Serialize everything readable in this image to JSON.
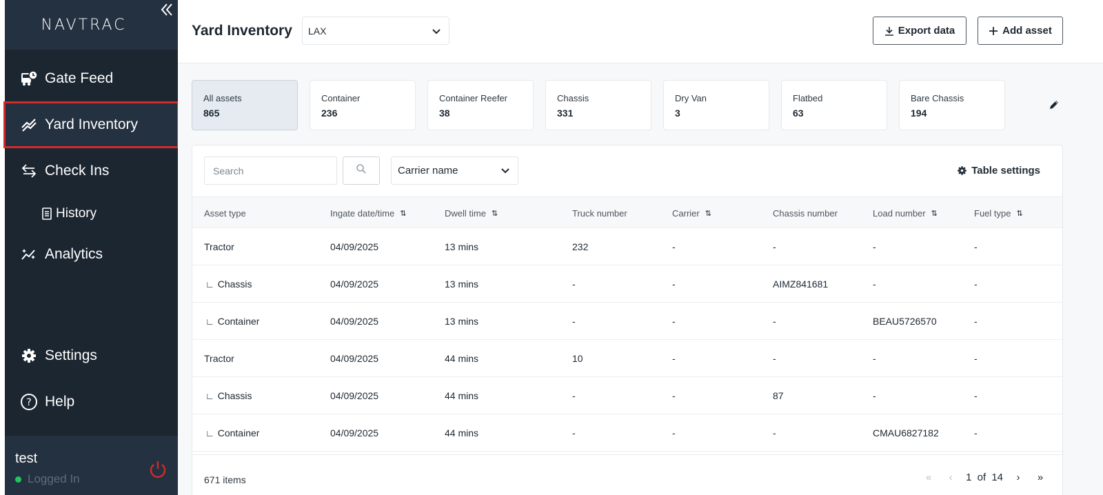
{
  "sidebar": {
    "logo": "NAVTRAC",
    "items": [
      {
        "label": "Gate Feed"
      },
      {
        "label": "Yard Inventory"
      },
      {
        "label": "Check Ins"
      },
      {
        "label": "History"
      },
      {
        "label": "Analytics"
      }
    ],
    "bottom": [
      {
        "label": "Settings"
      },
      {
        "label": "Help"
      }
    ],
    "user": {
      "name": "test",
      "status": "Logged In"
    }
  },
  "header": {
    "title": "Yard Inventory",
    "location": "LAX",
    "export_label": "Export data",
    "add_label": "Add asset"
  },
  "cards": [
    {
      "label": "All assets",
      "value": "865"
    },
    {
      "label": "Container",
      "value": "236"
    },
    {
      "label": "Container Reefer",
      "value": "38"
    },
    {
      "label": "Chassis",
      "value": "331"
    },
    {
      "label": "Dry Van",
      "value": "3"
    },
    {
      "label": "Flatbed",
      "value": "63"
    },
    {
      "label": "Bare Chassis",
      "value": "194"
    }
  ],
  "toolbar": {
    "search_placeholder": "Search",
    "carrier_label": "Carrier name",
    "table_settings": "Table settings"
  },
  "table": {
    "columns": [
      "Asset type",
      "Ingate date/time",
      "Dwell time",
      "Truck number",
      "Carrier",
      "Chassis number",
      "Load number",
      "Fuel type"
    ],
    "rows": [
      {
        "asset": "Tractor",
        "child": false,
        "ingate": "04/09/2025",
        "dwell": "13 mins",
        "truck": "232",
        "carrier": "-",
        "chassis": "-",
        "load": "-",
        "fuel": "-"
      },
      {
        "asset": "Chassis",
        "child": true,
        "ingate": "04/09/2025",
        "dwell": "13 mins",
        "truck": "-",
        "carrier": "-",
        "chassis": "AIMZ841681",
        "load": "-",
        "fuel": "-"
      },
      {
        "asset": "Container",
        "child": true,
        "ingate": "04/09/2025",
        "dwell": "13 mins",
        "truck": "-",
        "carrier": "-",
        "chassis": "-",
        "load": "BEAU5726570",
        "fuel": "-"
      },
      {
        "asset": "Tractor",
        "child": false,
        "ingate": "04/09/2025",
        "dwell": "44 mins",
        "truck": "10",
        "carrier": "-",
        "chassis": "-",
        "load": "-",
        "fuel": "-"
      },
      {
        "asset": "Chassis",
        "child": true,
        "ingate": "04/09/2025",
        "dwell": "44 mins",
        "truck": "-",
        "carrier": "-",
        "chassis": "87",
        "load": "-",
        "fuel": "-"
      },
      {
        "asset": "Container",
        "child": true,
        "ingate": "04/09/2025",
        "dwell": "44 mins",
        "truck": "-",
        "carrier": "-",
        "chassis": "-",
        "load": "CMAU6827182",
        "fuel": "-"
      }
    ]
  },
  "footer": {
    "items_count": "671 items",
    "page": "1",
    "of_label": "of",
    "total_pages": "14"
  },
  "colors": {
    "sidebar_bg": "#1c2631",
    "highlight": "#d32a2a",
    "online": "#22c55e"
  }
}
